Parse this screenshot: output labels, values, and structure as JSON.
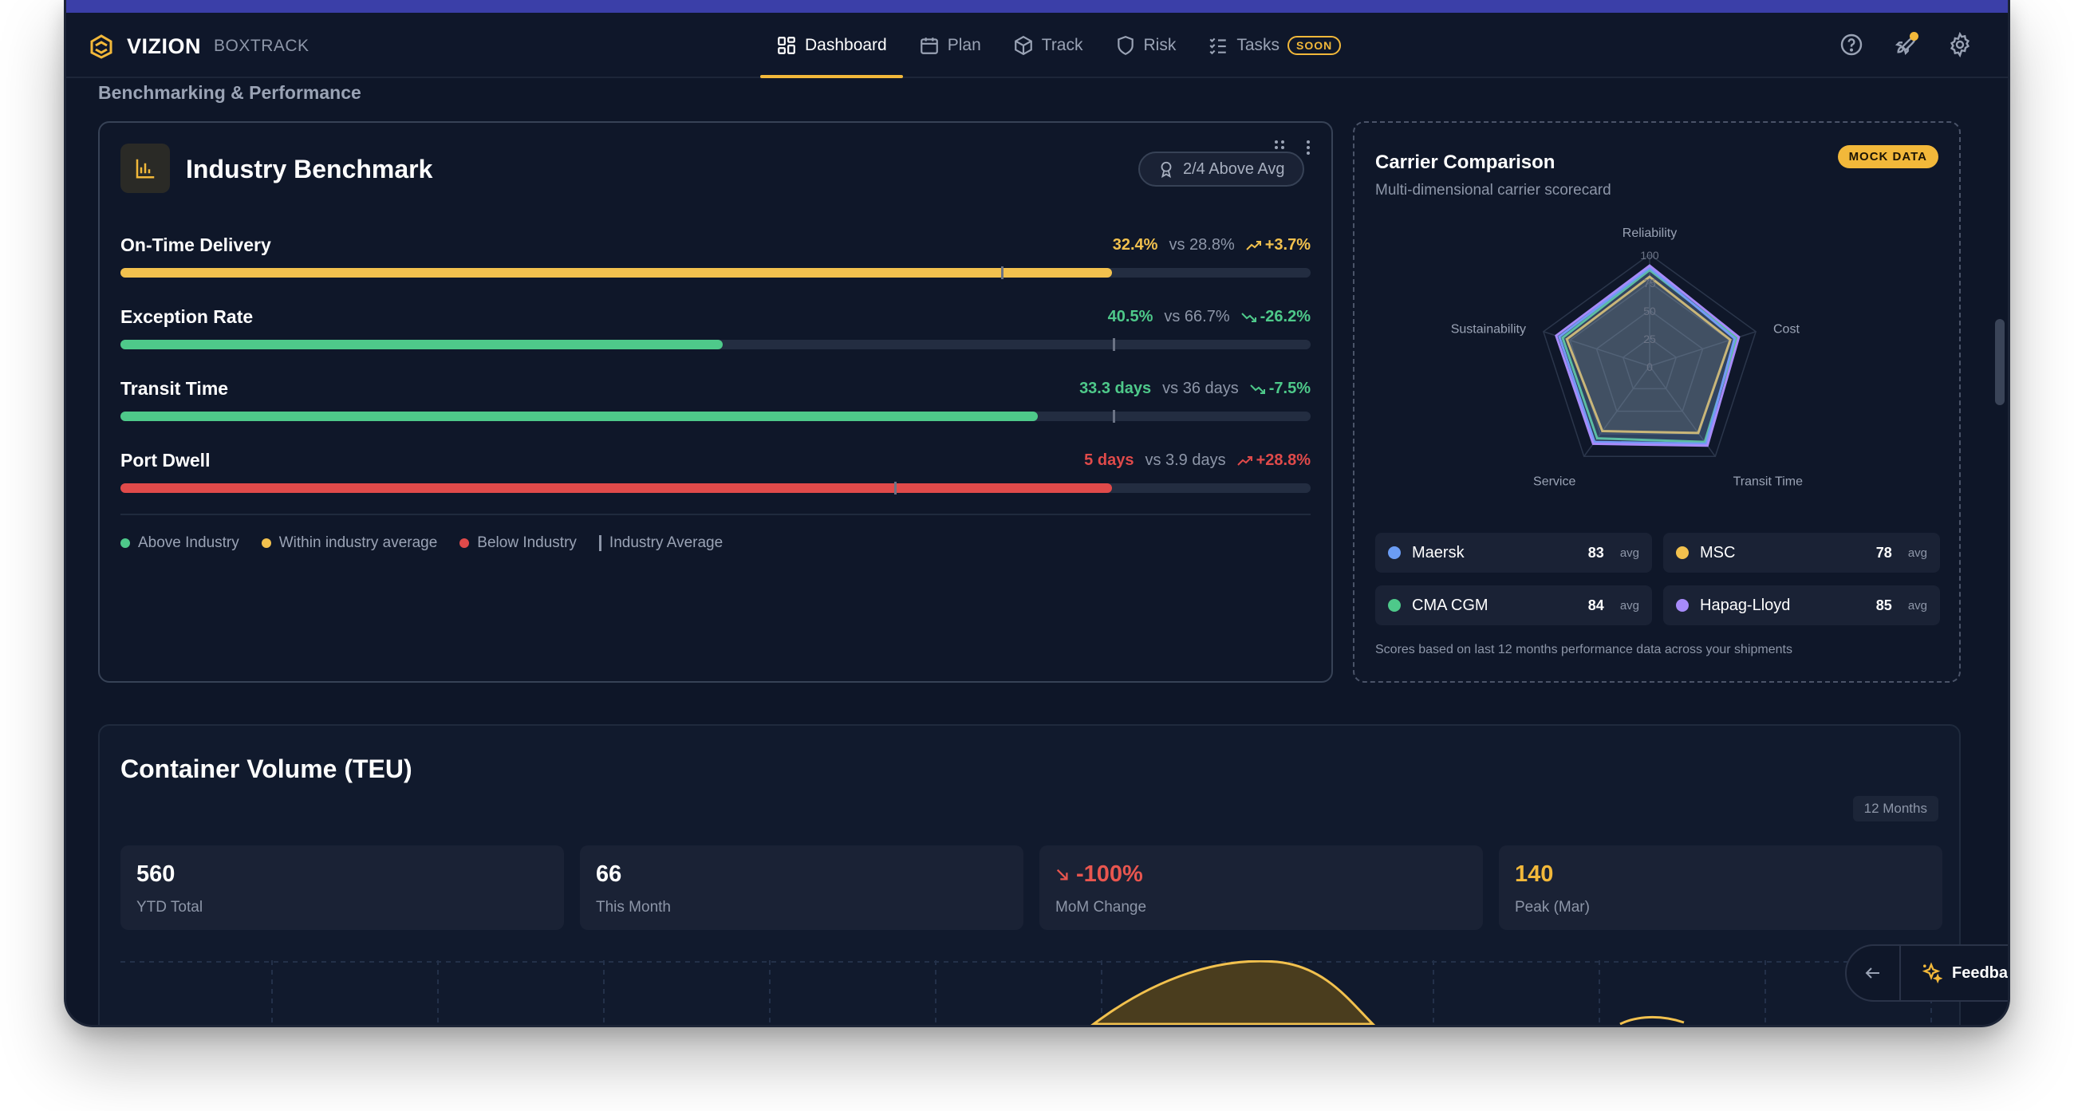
{
  "nav": {
    "brand": "VIZION",
    "brand_sub": "BOXTRACK",
    "items": [
      {
        "label": "Dashboard",
        "icon": "dashboard-icon",
        "active": true
      },
      {
        "label": "Plan",
        "icon": "calendar-icon"
      },
      {
        "label": "Track",
        "icon": "box-icon"
      },
      {
        "label": "Risk",
        "icon": "shield-icon"
      },
      {
        "label": "Tasks",
        "icon": "checklist-icon",
        "badge": "SOON"
      }
    ],
    "right_icons": [
      "help-icon",
      "rocket-icon",
      "settings-icon"
    ]
  },
  "section_title": "Benchmarking & Performance",
  "benchmark": {
    "title": "Industry Benchmark",
    "icon": "bar-chart-icon",
    "badge": "2/4 Above Avg",
    "metrics": [
      {
        "name": "On-Time Delivery",
        "value": "32.4%",
        "vs": "vs 28.8%",
        "delta": "+3.7%",
        "trend": "up",
        "status": "within",
        "fill_pct": 83.3,
        "avg_pct": 74
      },
      {
        "name": "Exception Rate",
        "value": "40.5%",
        "vs": "vs 66.7%",
        "delta": "-26.2%",
        "trend": "down",
        "status": "above",
        "fill_pct": 50.6,
        "avg_pct": 83.4
      },
      {
        "name": "Transit Time",
        "value": "33.3 days",
        "vs": "vs 36 days",
        "delta": "-7.5%",
        "trend": "down",
        "status": "above",
        "fill_pct": 77.1,
        "avg_pct": 83.4
      },
      {
        "name": "Port Dwell",
        "value": "5 days",
        "vs": "vs 3.9 days",
        "delta": "+28.8%",
        "trend": "up",
        "status": "below",
        "fill_pct": 83.3,
        "avg_pct": 65
      }
    ],
    "legend": {
      "above": "Above Industry",
      "within": "Within industry average",
      "below": "Below Industry",
      "avg": "Industry Average"
    },
    "colors": {
      "above": "#4ec98a",
      "within": "#f2c14e",
      "below": "#e04a4a"
    }
  },
  "carrier": {
    "title": "Carrier Comparison",
    "subtitle": "Multi-dimensional carrier scorecard",
    "badge": "MOCK DATA",
    "axes": [
      "Reliability",
      "Cost",
      "Transit Time",
      "Service",
      "Sustainability"
    ],
    "ticks": [
      "100",
      "75",
      "50",
      "25",
      "0"
    ],
    "carriers": [
      {
        "name": "Maersk",
        "score": "83",
        "unit": "avg",
        "color": "#6b9df5",
        "values": [
          88,
          80,
          86,
          84,
          85
        ]
      },
      {
        "name": "MSC",
        "score": "78",
        "unit": "avg",
        "color": "#f2c14e",
        "values": [
          80,
          76,
          74,
          72,
          78
        ]
      },
      {
        "name": "CMA CGM",
        "score": "84",
        "unit": "avg",
        "color": "#4ec98a",
        "values": [
          86,
          82,
          84,
          80,
          82
        ]
      },
      {
        "name": "Hapag-Lloyd",
        "score": "85",
        "unit": "avg",
        "color": "#a78bfa",
        "values": [
          90,
          84,
          88,
          86,
          88
        ]
      }
    ],
    "footnote": "Scores based on last 12 months performance data across your shipments"
  },
  "volume": {
    "title": "Container Volume (TEU)",
    "period": "12 Months",
    "stats": [
      {
        "value": "560",
        "label": "YTD Total",
        "color": "#ffffff"
      },
      {
        "value": "66",
        "label": "This Month",
        "color": "#ffffff"
      },
      {
        "value": "-100%",
        "label": "MoM Change",
        "color": "#e8564f",
        "icon": "arrow-down-right-icon"
      },
      {
        "value": "140",
        "label": "Peak (Mar)",
        "color": "#f2b83a"
      }
    ]
  },
  "feedback": {
    "label": "Feedback"
  }
}
